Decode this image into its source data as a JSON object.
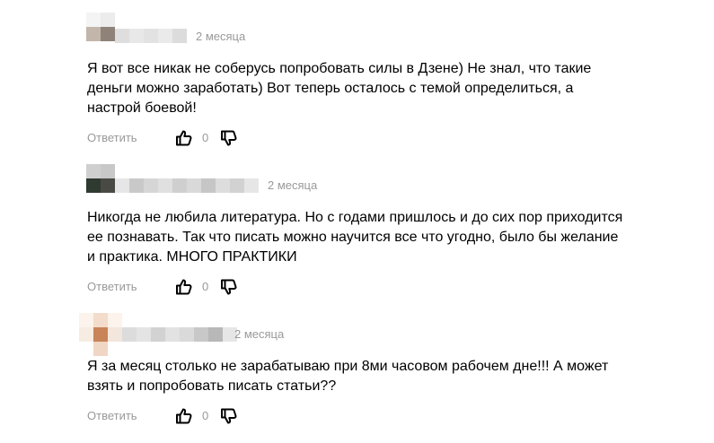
{
  "comments": [
    {
      "time": "2 месяца",
      "text_lines": [
        "Я вот все никак не соберусь попробовать силы в Дзене) Не знал, что такие",
        "деньги можно заработать) Вот теперь осталось с темой определиться, а",
        "настрой боевой!"
      ],
      "reply_label": "Ответить",
      "likes": "0",
      "like_icon": "thumbs-up-icon",
      "dislike_icon": "thumbs-down-icon"
    },
    {
      "time": "2 месяца",
      "text_lines": [
        "Никогда не любила литература. Но с годами пришлось и до сих пор приходится",
        "ее познавать. Так что писать можно научится все что угодно, было бы желание",
        "и практика. МНОГО ПРАКТИКИ"
      ],
      "reply_label": "Ответить",
      "likes": "0",
      "like_icon": "thumbs-up-icon",
      "dislike_icon": "thumbs-down-icon"
    },
    {
      "time": "2 месяца",
      "text_lines": [
        "Я за месяц столько не зарабатываю при 8ми часовом рабочем дне!!! А может",
        "взять и попробовать писать статьи??"
      ],
      "reply_label": "Ответить",
      "likes": "0",
      "like_icon": "thumbs-up-icon",
      "dislike_icon": "thumbs-down-icon"
    }
  ]
}
